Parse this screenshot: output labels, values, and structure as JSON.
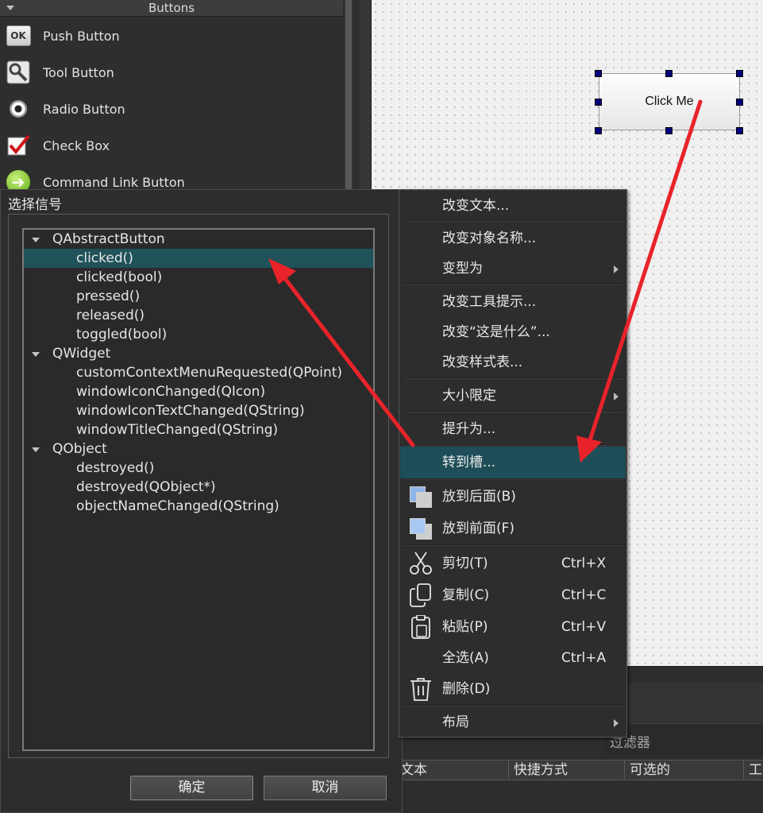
{
  "widget_box": {
    "category": "Buttons",
    "items": [
      {
        "label": "Push Button",
        "icon": "push-button-icon",
        "icon_text": "OK"
      },
      {
        "label": "Tool Button",
        "icon": "tool-button-icon"
      },
      {
        "label": "Radio Button",
        "icon": "radio-button-icon"
      },
      {
        "label": "Check Box",
        "icon": "check-box-icon"
      },
      {
        "label": "Command Link Button",
        "icon": "command-link-icon",
        "icon_text": "➔"
      }
    ]
  },
  "canvas": {
    "button_label": "Click Me"
  },
  "signal_dialog": {
    "title": "选择信号",
    "groups": [
      {
        "name": "QAbstractButton",
        "signals": [
          "clicked()",
          "clicked(bool)",
          "pressed()",
          "released()",
          "toggled(bool)"
        ]
      },
      {
        "name": "QWidget",
        "signals": [
          "customContextMenuRequested(QPoint)",
          "windowIconChanged(QIcon)",
          "windowIconTextChanged(QString)",
          "windowTitleChanged(QString)"
        ]
      },
      {
        "name": "QObject",
        "signals": [
          "destroyed()",
          "destroyed(QObject*)",
          "objectNameChanged(QString)"
        ]
      }
    ],
    "selected_signal": "clicked()",
    "ok_label": "确定",
    "cancel_label": "取消"
  },
  "context_menu": {
    "items": {
      "change_text": "改变文本...",
      "change_object_name": "改变对象名称...",
      "morph_into": "变型为",
      "change_tooltip": "改变工具提示...",
      "change_whats_this": "改变“这是什么”...",
      "change_stylesheet": "改变样式表...",
      "size_constraints": "大小限定",
      "promote_to": "提升为...",
      "go_to_slot": "转到槽...",
      "send_to_back": "放到后面(B)",
      "bring_to_front": "放到前面(F)",
      "cut": "剪切(T)",
      "cut_shortcut": "Ctrl+X",
      "copy": "复制(C)",
      "copy_shortcut": "Ctrl+C",
      "paste": "粘贴(P)",
      "paste_shortcut": "Ctrl+V",
      "select_all": "全选(A)",
      "select_all_shortcut": "Ctrl+A",
      "delete": "删除(D)",
      "layout": "布局"
    }
  },
  "action_editor": {
    "filter_placeholder": "过滤器",
    "columns": [
      "文本",
      "快捷方式",
      "可选的",
      "工"
    ]
  },
  "colors": {
    "selection": "#20525a",
    "menu_highlight": "#1f4e58",
    "arrow": "#e8232a",
    "handle": "#00007d"
  }
}
